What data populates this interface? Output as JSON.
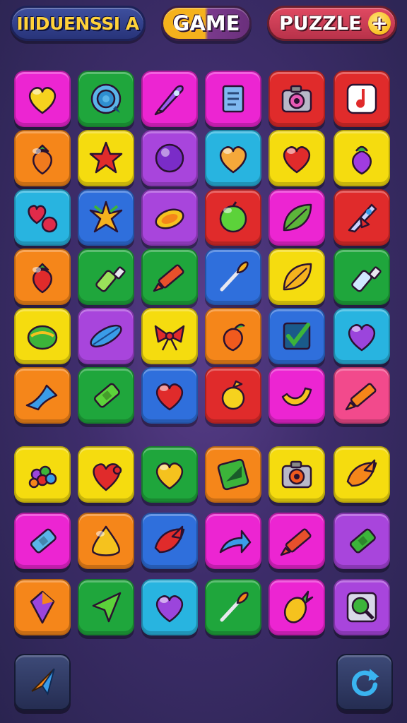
{
  "header": {
    "title": "IIIDUENSSI A",
    "game_label": "GAME",
    "puzzle_label": "PUZZLE",
    "plus_symbol": "+"
  },
  "colors": {
    "pink": "#ec25d2",
    "green": "#1fa63c",
    "purple": "#a845dc",
    "red": "#e02b2b",
    "orange": "#f5861a",
    "yellow": "#f5dc0f",
    "cyan": "#28b4e0",
    "blue": "#2f6fdc",
    "hotpink": "#f24a8c"
  },
  "board": {
    "rows": [
      [
        {
          "bg": "pink",
          "icon": "heart-icon",
          "fg": "#f5d21e"
        },
        {
          "bg": "green",
          "icon": "target-icon",
          "fg": "#5ab4e8"
        },
        {
          "bg": "pink",
          "icon": "rocket-icon",
          "fg": "#9b5cf0"
        },
        {
          "bg": "pink",
          "icon": "document-icon",
          "fg": "#7fb8f0"
        },
        {
          "bg": "red",
          "icon": "camera-icon",
          "fg": "#e85ab4"
        },
        {
          "bg": "red",
          "icon": "music-note-icon",
          "fg": "#ffffff"
        }
      ],
      [
        {
          "bg": "orange",
          "icon": "strawberry-icon",
          "fg": "#f07a1e"
        },
        {
          "bg": "yellow",
          "icon": "star-burst-icon",
          "fg": "#e02b2b"
        },
        {
          "bg": "purple",
          "icon": "orb-icon",
          "fg": "#7a2cc8"
        },
        {
          "bg": "cyan",
          "icon": "heart-icon",
          "fg": "#f5a83a"
        },
        {
          "bg": "yellow",
          "icon": "heart-icon",
          "fg": "#e02b2b"
        },
        {
          "bg": "yellow",
          "icon": "berry-icon",
          "fg": "#a03ce0"
        }
      ],
      [
        {
          "bg": "cyan",
          "icon": "hearts-icon",
          "fg": "#e02b4a"
        },
        {
          "bg": "blue",
          "icon": "leaf-star-icon",
          "fg": "#f5b21e"
        },
        {
          "bg": "purple",
          "icon": "lemon-icon",
          "fg": "#f5c21e"
        },
        {
          "bg": "red",
          "icon": "lime-icon",
          "fg": "#5cd23a"
        },
        {
          "bg": "pink",
          "icon": "leaf-icon",
          "fg": "#5cb43a"
        },
        {
          "bg": "red",
          "icon": "spaceship-icon",
          "fg": "#c8d2ff"
        }
      ],
      [
        {
          "bg": "orange",
          "icon": "strawberry-icon",
          "fg": "#e02b2b"
        },
        {
          "bg": "green",
          "icon": "bottle-icon",
          "fg": "#9be05a"
        },
        {
          "bg": "green",
          "icon": "crayon-icon",
          "fg": "#e8502b"
        },
        {
          "bg": "blue",
          "icon": "paintbrush-icon",
          "fg": "#f5b21e"
        },
        {
          "bg": "yellow",
          "icon": "leaf-icon",
          "fg": "#f5b21e"
        },
        {
          "bg": "green",
          "icon": "bottle-icon",
          "fg": "#cfe8ff"
        }
      ],
      [
        {
          "bg": "yellow",
          "icon": "melon-icon",
          "fg": "#3cb43a"
        },
        {
          "bg": "purple",
          "icon": "feather-icon",
          "fg": "#3a9ce8"
        },
        {
          "bg": "yellow",
          "icon": "bow-icon",
          "fg": "#e02b2b"
        },
        {
          "bg": "orange",
          "icon": "peach-icon",
          "fg": "#f05a1e"
        },
        {
          "bg": "blue",
          "icon": "checkbox-icon",
          "fg": "#3cb43a"
        },
        {
          "bg": "cyan",
          "icon": "heart-icon",
          "fg": "#9b45dc"
        }
      ],
      [
        {
          "bg": "orange",
          "icon": "wave-icon",
          "fg": "#3a9ce8"
        },
        {
          "bg": "green",
          "icon": "battery-icon",
          "fg": "#5cd23a"
        },
        {
          "bg": "blue",
          "icon": "heart-icon",
          "fg": "#e02b2b"
        },
        {
          "bg": "red",
          "icon": "apple-icon",
          "fg": "#f5d21e"
        },
        {
          "bg": "pink",
          "icon": "banana-icon",
          "fg": "#f5c21e"
        },
        {
          "bg": "hotpink",
          "icon": "crayon-icon",
          "fg": "#f5861a"
        }
      ]
    ]
  },
  "tray": {
    "rows": [
      [
        {
          "bg": "yellow",
          "icon": "grapes-icon",
          "fg": "#9b45dc"
        },
        {
          "bg": "yellow",
          "icon": "puzzle-heart-icon",
          "fg": "#e02b2b"
        },
        {
          "bg": "green",
          "icon": "heart-icon",
          "fg": "#f5c21e"
        },
        {
          "bg": "orange",
          "icon": "arrow-box-icon",
          "fg": "#3cb43a"
        },
        {
          "bg": "yellow",
          "icon": "camera-icon",
          "fg": "#f05a1e"
        },
        {
          "bg": "yellow",
          "icon": "bird-icon",
          "fg": "#f5861a"
        }
      ],
      [
        {
          "bg": "pink",
          "icon": "battery-icon",
          "fg": "#5ab4e8"
        },
        {
          "bg": "orange",
          "icon": "triangle-icon",
          "fg": "#f5c21e"
        },
        {
          "bg": "blue",
          "icon": "bird-icon",
          "fg": "#e02b2b"
        },
        {
          "bg": "pink",
          "icon": "curved-arrow-icon",
          "fg": "#3a9ce8"
        },
        {
          "bg": "pink",
          "icon": "crayon-icon",
          "fg": "#e8502b"
        },
        {
          "bg": "purple",
          "icon": "battery-icon",
          "fg": "#3cb43a"
        }
      ],
      [
        {
          "bg": "orange",
          "icon": "gem-icon",
          "fg": "#9b45dc"
        },
        {
          "bg": "green",
          "icon": "arrow-cursor-icon",
          "fg": "#5cd23a"
        },
        {
          "bg": "cyan",
          "icon": "heart-icon",
          "fg": "#9b45dc"
        },
        {
          "bg": "green",
          "icon": "paintbrush-icon",
          "fg": "#f5861a"
        },
        {
          "bg": "pink",
          "icon": "pineapple-icon",
          "fg": "#f5c21e"
        },
        {
          "bg": "purple",
          "icon": "magnifier-icon",
          "fg": "#3cb43a"
        }
      ]
    ]
  },
  "controls": {
    "hint_icon": "compass-arrow-icon",
    "restart_icon": "refresh-icon"
  }
}
